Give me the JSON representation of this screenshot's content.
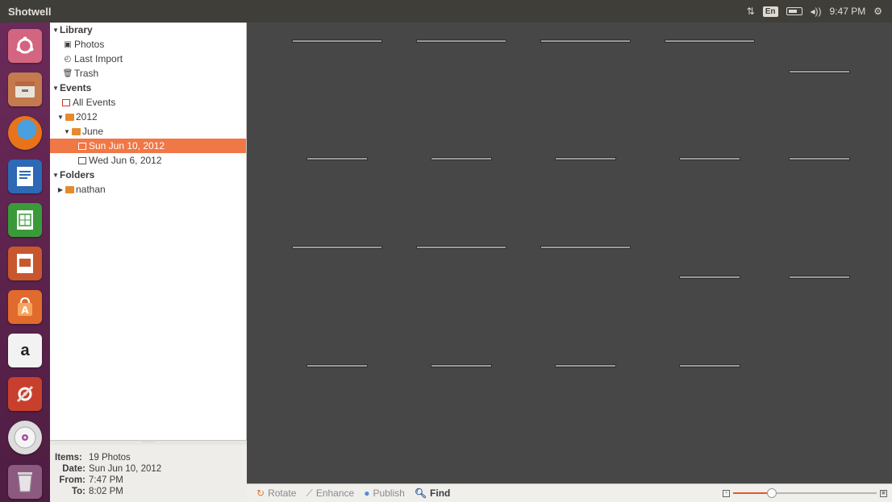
{
  "topbar": {
    "app_title": "Shotwell",
    "keyboard_layout": "En",
    "clock": "9:47 PM",
    "icons": [
      "network-icon",
      "keyboard-icon",
      "battery-icon",
      "volume-icon",
      "settings-gear-icon"
    ]
  },
  "launcher": {
    "items": [
      "dash-icon",
      "files-icon",
      "firefox-icon",
      "writer-icon",
      "calc-icon",
      "impress-icon",
      "software-center-icon",
      "amazon-icon",
      "system-settings-icon",
      "disc-icon",
      "trash-icon"
    ],
    "amazon_glyph": "a"
  },
  "sidebar": {
    "library": "Library",
    "photos": "Photos",
    "last_import": "Last Import",
    "trash": "Trash",
    "events": "Events",
    "all_events": "All Events",
    "year": "2012",
    "month": "June",
    "event_selected": "Sun Jun 10, 2012",
    "event_other": "Wed Jun 6, 2012",
    "folders": "Folders",
    "user_folder": "nathan"
  },
  "info": {
    "items_label": "Items:",
    "items_value": "19 Photos",
    "date_label": "Date:",
    "date_value": "Sun Jun 10, 2012",
    "from_label": "From:",
    "from_value": "7:47 PM",
    "to_label": "To:",
    "to_value": "8:02 PM"
  },
  "photos_count": 19,
  "toolbar": {
    "rotate": "Rotate",
    "enhance": "Enhance",
    "publish": "Publish",
    "find": "Find",
    "zoom_level": 0.27
  },
  "colors": {
    "selection": "#f07746",
    "launcher": "#5e2450",
    "viewer_bg": "#474747",
    "zoom_fill": "#e05a2a"
  }
}
